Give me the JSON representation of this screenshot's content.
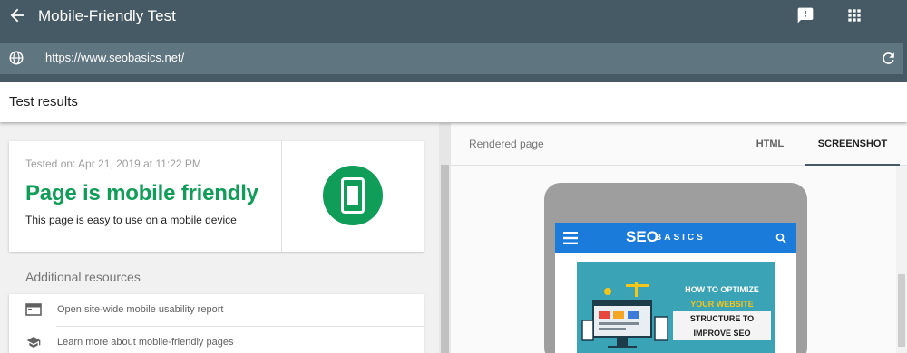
{
  "app": {
    "title": "Mobile-Friendly Test",
    "url": "https://www.seobasics.net/"
  },
  "results": {
    "title": "Test results"
  },
  "verdict": {
    "tested_on": "Tested on: Apr 21, 2019 at 11:22 PM",
    "headline": "Page is mobile friendly",
    "subtitle": "This page is easy to use on a mobile device"
  },
  "resources": {
    "title": "Additional resources",
    "items": [
      {
        "label": "Open site-wide mobile usability report",
        "icon": "browser-window-icon"
      },
      {
        "label": "Learn more about mobile-friendly pages",
        "icon": "school-cap-icon"
      }
    ]
  },
  "preview": {
    "label": "Rendered page",
    "tabs": [
      {
        "label": "HTML",
        "selected": false
      },
      {
        "label": "SCREENSHOT",
        "selected": true
      }
    ],
    "site": {
      "logo_main": "SEO",
      "logo_sub": "BASICS",
      "hero_lines": [
        "HOW TO OPTIMIZE",
        "YOUR WEBSITE",
        "STRUCTURE TO",
        "IMPROVE SEO"
      ]
    }
  },
  "colors": {
    "app_bar": "#455a64",
    "success": "#0f9d58",
    "site_nav": "#1a7bdb",
    "hero_bg": "#3aa3b5"
  }
}
